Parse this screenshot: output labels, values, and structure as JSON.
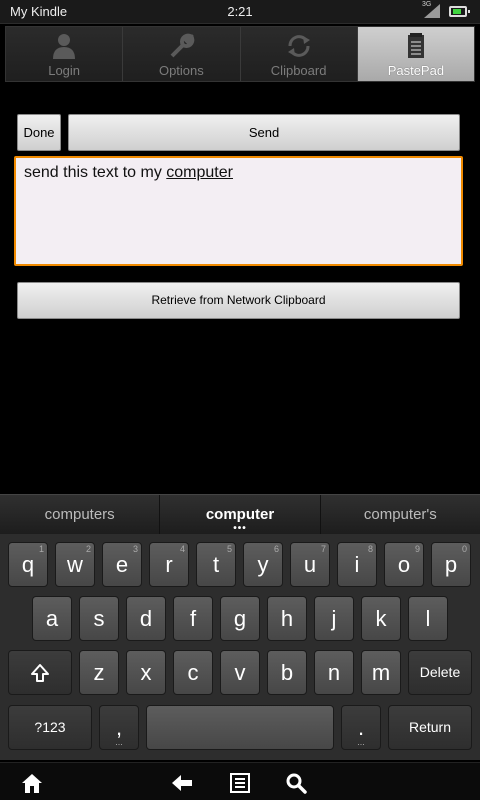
{
  "status": {
    "device_name": "My Kindle",
    "time": "2:21",
    "network": "3G"
  },
  "tabs": [
    {
      "label": "Login",
      "icon": "person-icon",
      "active": false
    },
    {
      "label": "Options",
      "icon": "wrench-icon",
      "active": false
    },
    {
      "label": "Clipboard",
      "icon": "sync-icon",
      "active": false
    },
    {
      "label": "PastePad",
      "icon": "notepad-icon",
      "active": true
    }
  ],
  "actions": {
    "done_label": "Done",
    "send_label": "Send",
    "retrieve_label": "Retrieve from Network Clipboard"
  },
  "pastepad": {
    "text_before": "send this text to my ",
    "text_word": "computer"
  },
  "suggestions": {
    "left": "computers",
    "center": "computer",
    "center_dots": "•••",
    "right": "computer's"
  },
  "keyboard": {
    "row1": [
      {
        "k": "q",
        "h": "1"
      },
      {
        "k": "w",
        "h": "2"
      },
      {
        "k": "e",
        "h": "3"
      },
      {
        "k": "r",
        "h": "4"
      },
      {
        "k": "t",
        "h": "5"
      },
      {
        "k": "y",
        "h": "6"
      },
      {
        "k": "u",
        "h": "7"
      },
      {
        "k": "i",
        "h": "8"
      },
      {
        "k": "o",
        "h": "9"
      },
      {
        "k": "p",
        "h": "0"
      }
    ],
    "row2": [
      "a",
      "s",
      "d",
      "f",
      "g",
      "h",
      "j",
      "k",
      "l"
    ],
    "row3": [
      "z",
      "x",
      "c",
      "v",
      "b",
      "n",
      "m"
    ],
    "delete_label": "Delete",
    "symbols_label": "?123",
    "comma_label": ",",
    "period_label": ".",
    "ellipsis": "...",
    "return_label": "Return"
  }
}
